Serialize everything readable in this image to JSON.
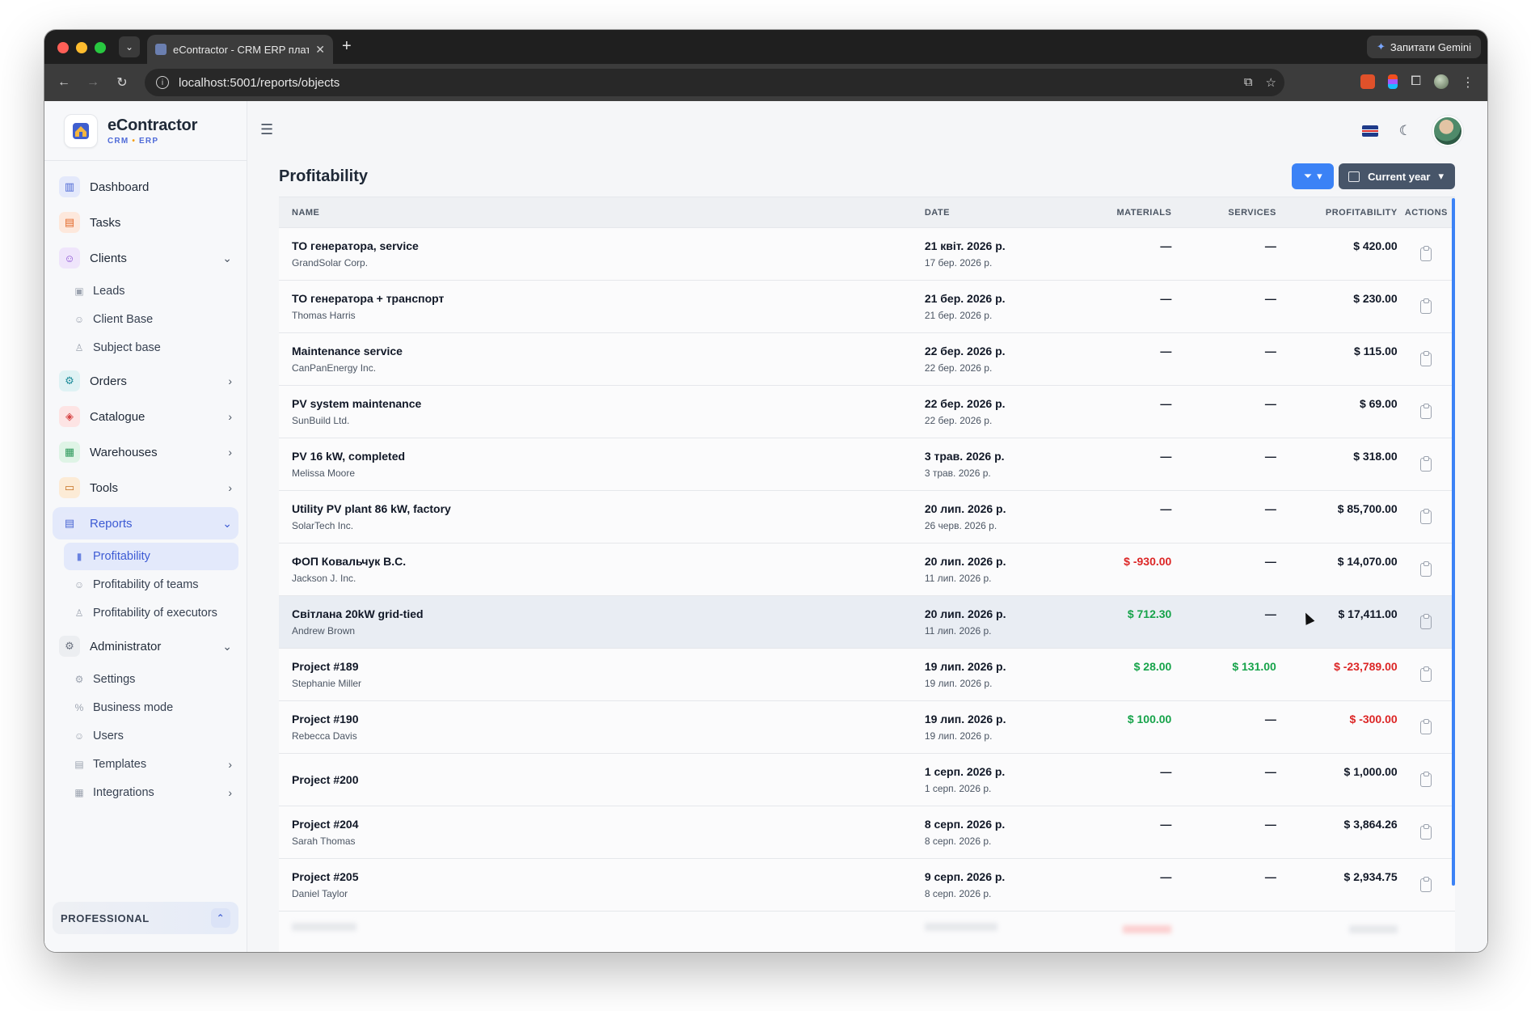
{
  "browser": {
    "tab_title": "eContractor - CRM ERP плат",
    "url": "localhost:5001/reports/objects",
    "gemini_label": "Запитати Gemini"
  },
  "brand": {
    "name": "eContractor",
    "sub_left": "CRM",
    "sub_dot": "•",
    "sub_right": "ERP"
  },
  "sidebar": {
    "dashboard": "Dashboard",
    "tasks": "Tasks",
    "clients": "Clients",
    "leads": "Leads",
    "client_base": "Client Base",
    "subject_base": "Subject base",
    "orders": "Orders",
    "catalogue": "Catalogue",
    "warehouses": "Warehouses",
    "tools": "Tools",
    "reports": "Reports",
    "profitability": "Profitability",
    "profitability_teams": "Profitability of teams",
    "profitability_executors": "Profitability of executors",
    "administrator": "Administrator",
    "settings": "Settings",
    "business_mode": "Business mode",
    "users": "Users",
    "templates": "Templates",
    "integrations": "Integrations",
    "plan": "PROFESSIONAL"
  },
  "page": {
    "title": "Profitability",
    "period_label": "Current year"
  },
  "table": {
    "headers": {
      "name": "NAME",
      "date": "DATE",
      "materials": "MATERIALS",
      "services": "SERVICES",
      "profitability": "PROFITABILITY",
      "actions": "ACTIONS"
    },
    "rows": [
      {
        "name": "ТО генератора, service",
        "client": "GrandSolar Corp.",
        "date": "21 квіт. 2026 р.",
        "date2": "17 бер. 2026 р.",
        "materials": "—",
        "services": "—",
        "profit": "$ 420.00"
      },
      {
        "name": "ТО генератора + транспорт",
        "client": "Thomas Harris",
        "date": "21 бер. 2026 р.",
        "date2": "21 бер. 2026 р.",
        "materials": "—",
        "services": "—",
        "profit": "$ 230.00"
      },
      {
        "name": "Maintenance service",
        "client": "CanPanEnergy Inc.",
        "date": "22 бер. 2026 р.",
        "date2": "22 бер. 2026 р.",
        "materials": "—",
        "services": "—",
        "profit": "$ 115.00"
      },
      {
        "name": "PV system maintenance",
        "client": "SunBuild Ltd.",
        "date": "22 бер. 2026 р.",
        "date2": "22 бер. 2026 р.",
        "materials": "—",
        "services": "—",
        "profit": "$ 69.00"
      },
      {
        "name": "PV 16 kW, completed",
        "client": "Melissa Moore",
        "date": "3 трав. 2026 р.",
        "date2": "3 трав. 2026 р.",
        "materials": "—",
        "services": "—",
        "profit": "$ 318.00"
      },
      {
        "name": "Utility PV plant 86 kW, factory",
        "client": "SolarTech Inc.",
        "date": "20 лип. 2026 р.",
        "date2": "26 черв. 2026 р.",
        "materials": "—",
        "services": "—",
        "profit": "$ 85,700.00"
      },
      {
        "name": "ФОП Ковальчук В.С.",
        "client": "Jackson J. Inc.",
        "date": "20 лип. 2026 р.",
        "date2": "11 лип. 2026 р.",
        "materials": "$ -930.00",
        "services": "—",
        "profit": "$ 14,070.00"
      },
      {
        "name": "Світлана 20kW grid-tied",
        "client": "Andrew Brown",
        "date": "20 лип. 2026 р.",
        "date2": "11 лип. 2026 р.",
        "materials": "$ 712.30",
        "services": "—",
        "profit": "$ 17,411.00"
      },
      {
        "name": "Project #189",
        "client": "Stephanie Miller",
        "date": "19 лип. 2026 р.",
        "date2": "19 лип. 2026 р.",
        "materials": "$ 28.00",
        "services": "$ 131.00",
        "profit": "$ -23,789.00"
      },
      {
        "name": "Project #190",
        "client": "Rebecca Davis",
        "date": "19 лип. 2026 р.",
        "date2": "19 лип. 2026 р.",
        "materials": "$ 100.00",
        "services": "—",
        "profit": "$ -300.00"
      },
      {
        "name": "Project #200",
        "client": "",
        "date": "1 серп. 2026 р.",
        "date2": "1 серп. 2026 р.",
        "materials": "—",
        "services": "—",
        "profit": "$ 1,000.00"
      },
      {
        "name": "Project #204",
        "client": "Sarah Thomas",
        "date": "8 серп. 2026 р.",
        "date2": "8 серп. 2026 р.",
        "materials": "—",
        "services": "—",
        "profit": "$ 3,864.26"
      },
      {
        "name": "Project #205",
        "client": "Daniel Taylor",
        "date": "9 серп. 2026 р.",
        "date2": "8 серп. 2026 р.",
        "materials": "—",
        "services": "—",
        "profit": "$ 2,934.75"
      }
    ]
  },
  "colors": {
    "accent": "#3b82f6",
    "negative": "#dc2626",
    "positive": "#16a34a",
    "active_nav": "#3d5bd4"
  }
}
